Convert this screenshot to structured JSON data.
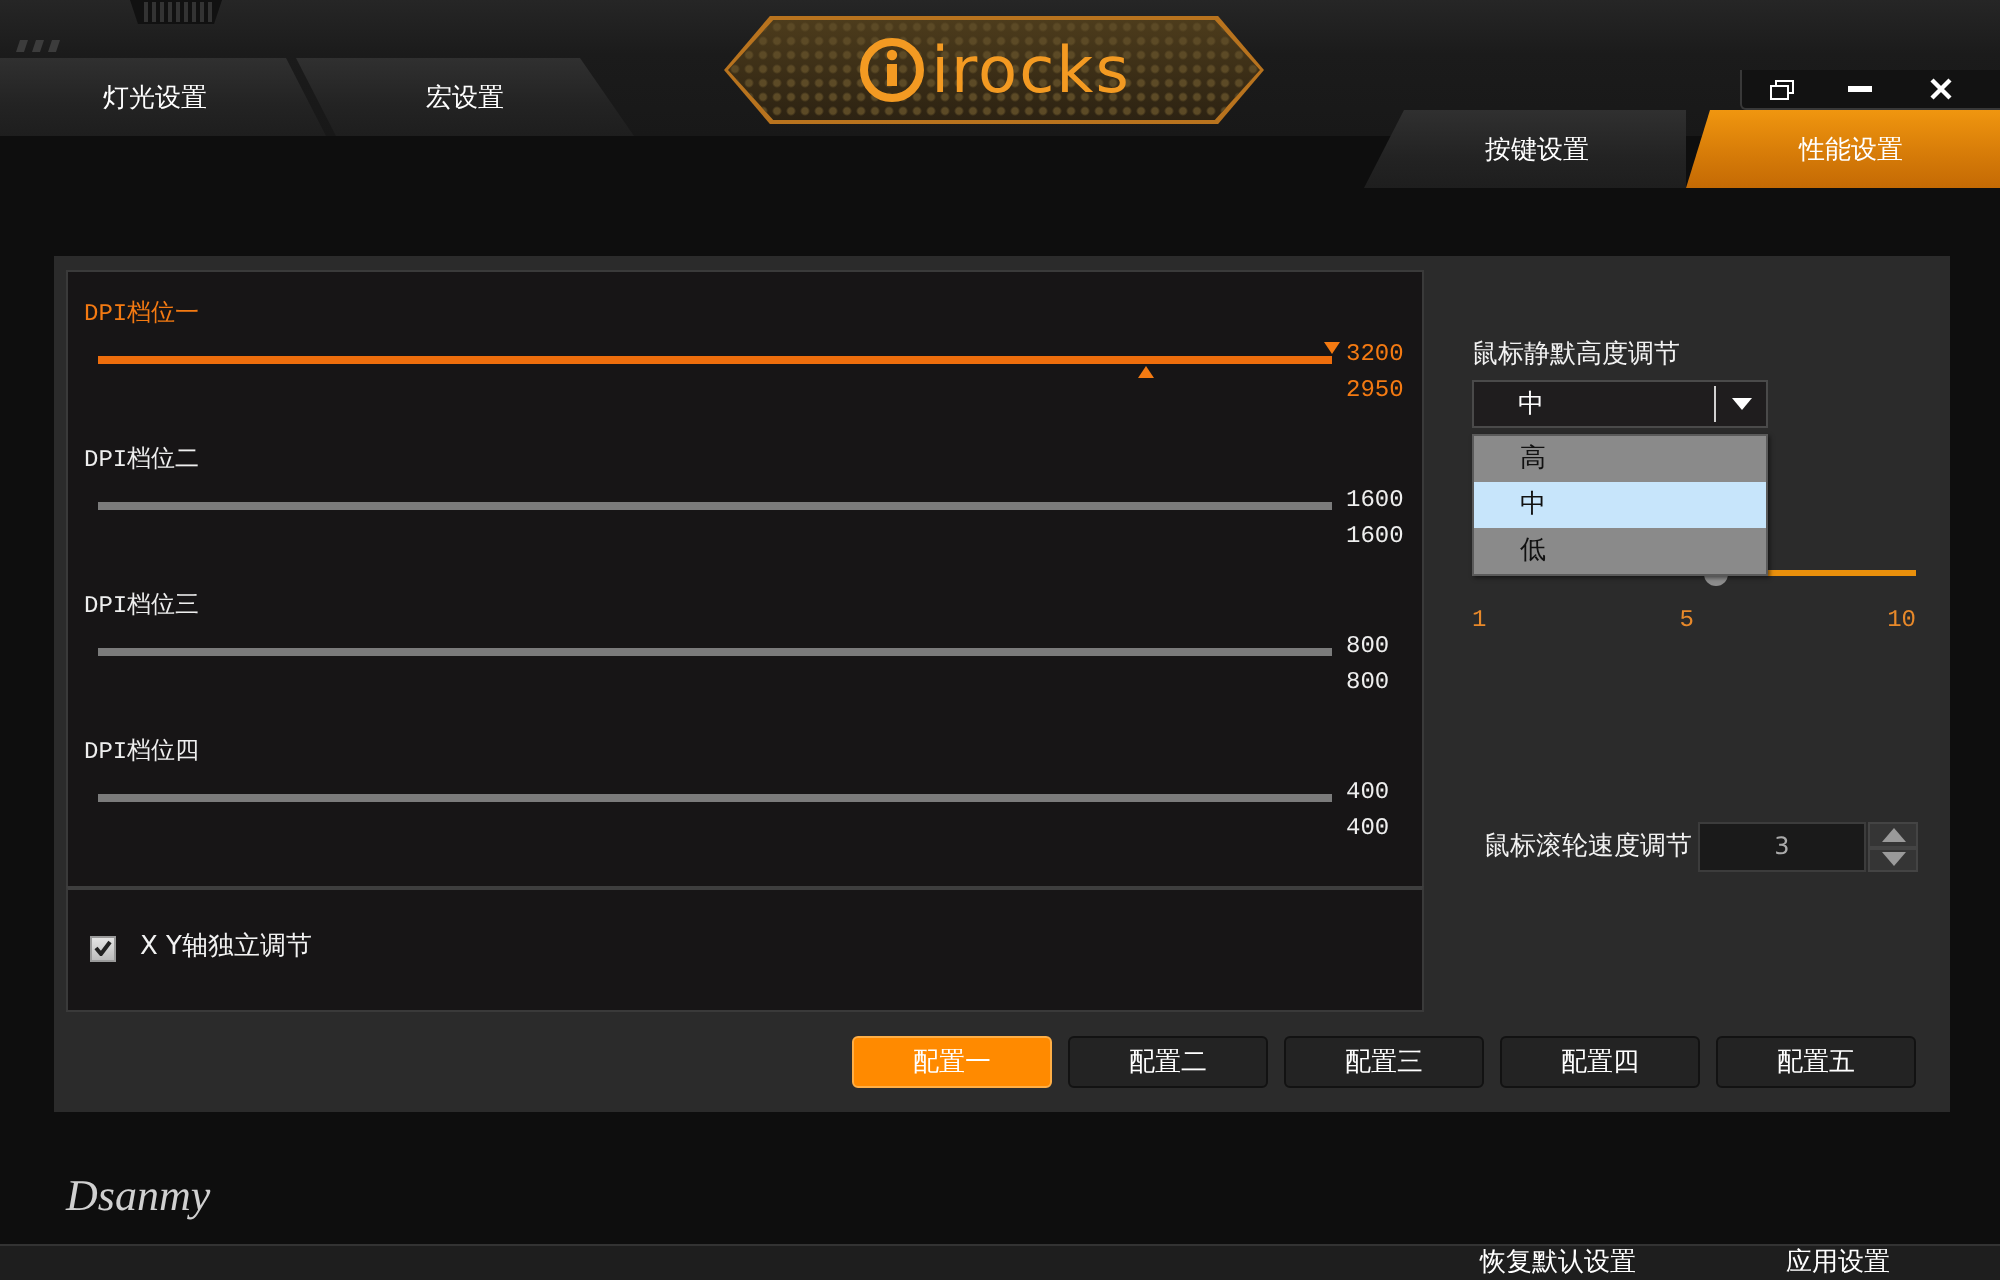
{
  "tabs": [
    {
      "label": "灯光设置",
      "selected": false
    },
    {
      "label": "宏设置",
      "selected": false
    },
    {
      "label": "按键设置",
      "selected": false
    },
    {
      "label": "性能设置",
      "selected": true
    }
  ],
  "logo": {
    "text": "irocks"
  },
  "dpi_levels": [
    {
      "label": "DPI档位一",
      "selected": true,
      "readings": [
        {
          "reading": "3200",
          "level": 1
        },
        {
          "reading": "2950",
          "level": 0.85
        }
      ]
    },
    {
      "label": "DPI档位二",
      "selected": false,
      "readings": [
        {
          "reading": "1600"
        },
        {
          "reading": "1600"
        }
      ]
    },
    {
      "label": "DPI档位三",
      "selected": false,
      "readings": [
        {
          "reading": "800"
        },
        {
          "reading": "800"
        }
      ]
    },
    {
      "label": "DPI档位四",
      "selected": false,
      "readings": [
        {
          "reading": "400"
        },
        {
          "reading": "400"
        }
      ]
    }
  ],
  "xy_independent": {
    "label": "X Y轴独立调节",
    "checked": true
  },
  "lift_off": {
    "label": "鼠标静默高度调节",
    "value": "中",
    "expanded": true,
    "options": [
      {
        "label": "高",
        "selected": false
      },
      {
        "label": "中",
        "selected": true
      },
      {
        "label": "低",
        "selected": false
      }
    ]
  },
  "lift_slider": {
    "level": 0.55,
    "ticks": [
      "1",
      "5",
      "10"
    ]
  },
  "scroll_speed": {
    "label": "鼠标滚轮速度调节",
    "value": "3"
  },
  "profiles": [
    {
      "label": "配置一",
      "selected": true
    },
    {
      "label": "配置二",
      "selected": false
    },
    {
      "label": "配置三",
      "selected": false
    },
    {
      "label": "配置四",
      "selected": false
    },
    {
      "label": "配置五",
      "selected": false
    }
  ],
  "brand": "Dsanmy",
  "footer_buttons": [
    "恢复默认设置",
    "应用设置"
  ]
}
